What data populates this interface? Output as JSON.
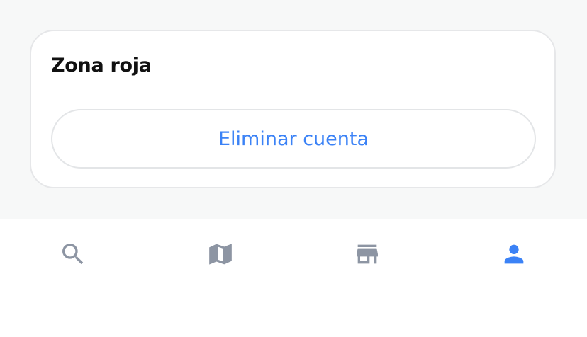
{
  "danger_zone": {
    "title": "Zona roja",
    "delete_account_label": "Eliminar cuenta"
  },
  "bottom_nav": {
    "items": [
      {
        "icon": "search-icon",
        "active": false
      },
      {
        "icon": "map-icon",
        "active": false
      },
      {
        "icon": "store-icon",
        "active": false
      },
      {
        "icon": "person-icon",
        "active": true
      }
    ]
  },
  "colors": {
    "accent": "#3b82f6",
    "inactive_icon": "#8d95a3",
    "page_background": "#f7f8f8",
    "card_border": "#e6e7e9"
  }
}
